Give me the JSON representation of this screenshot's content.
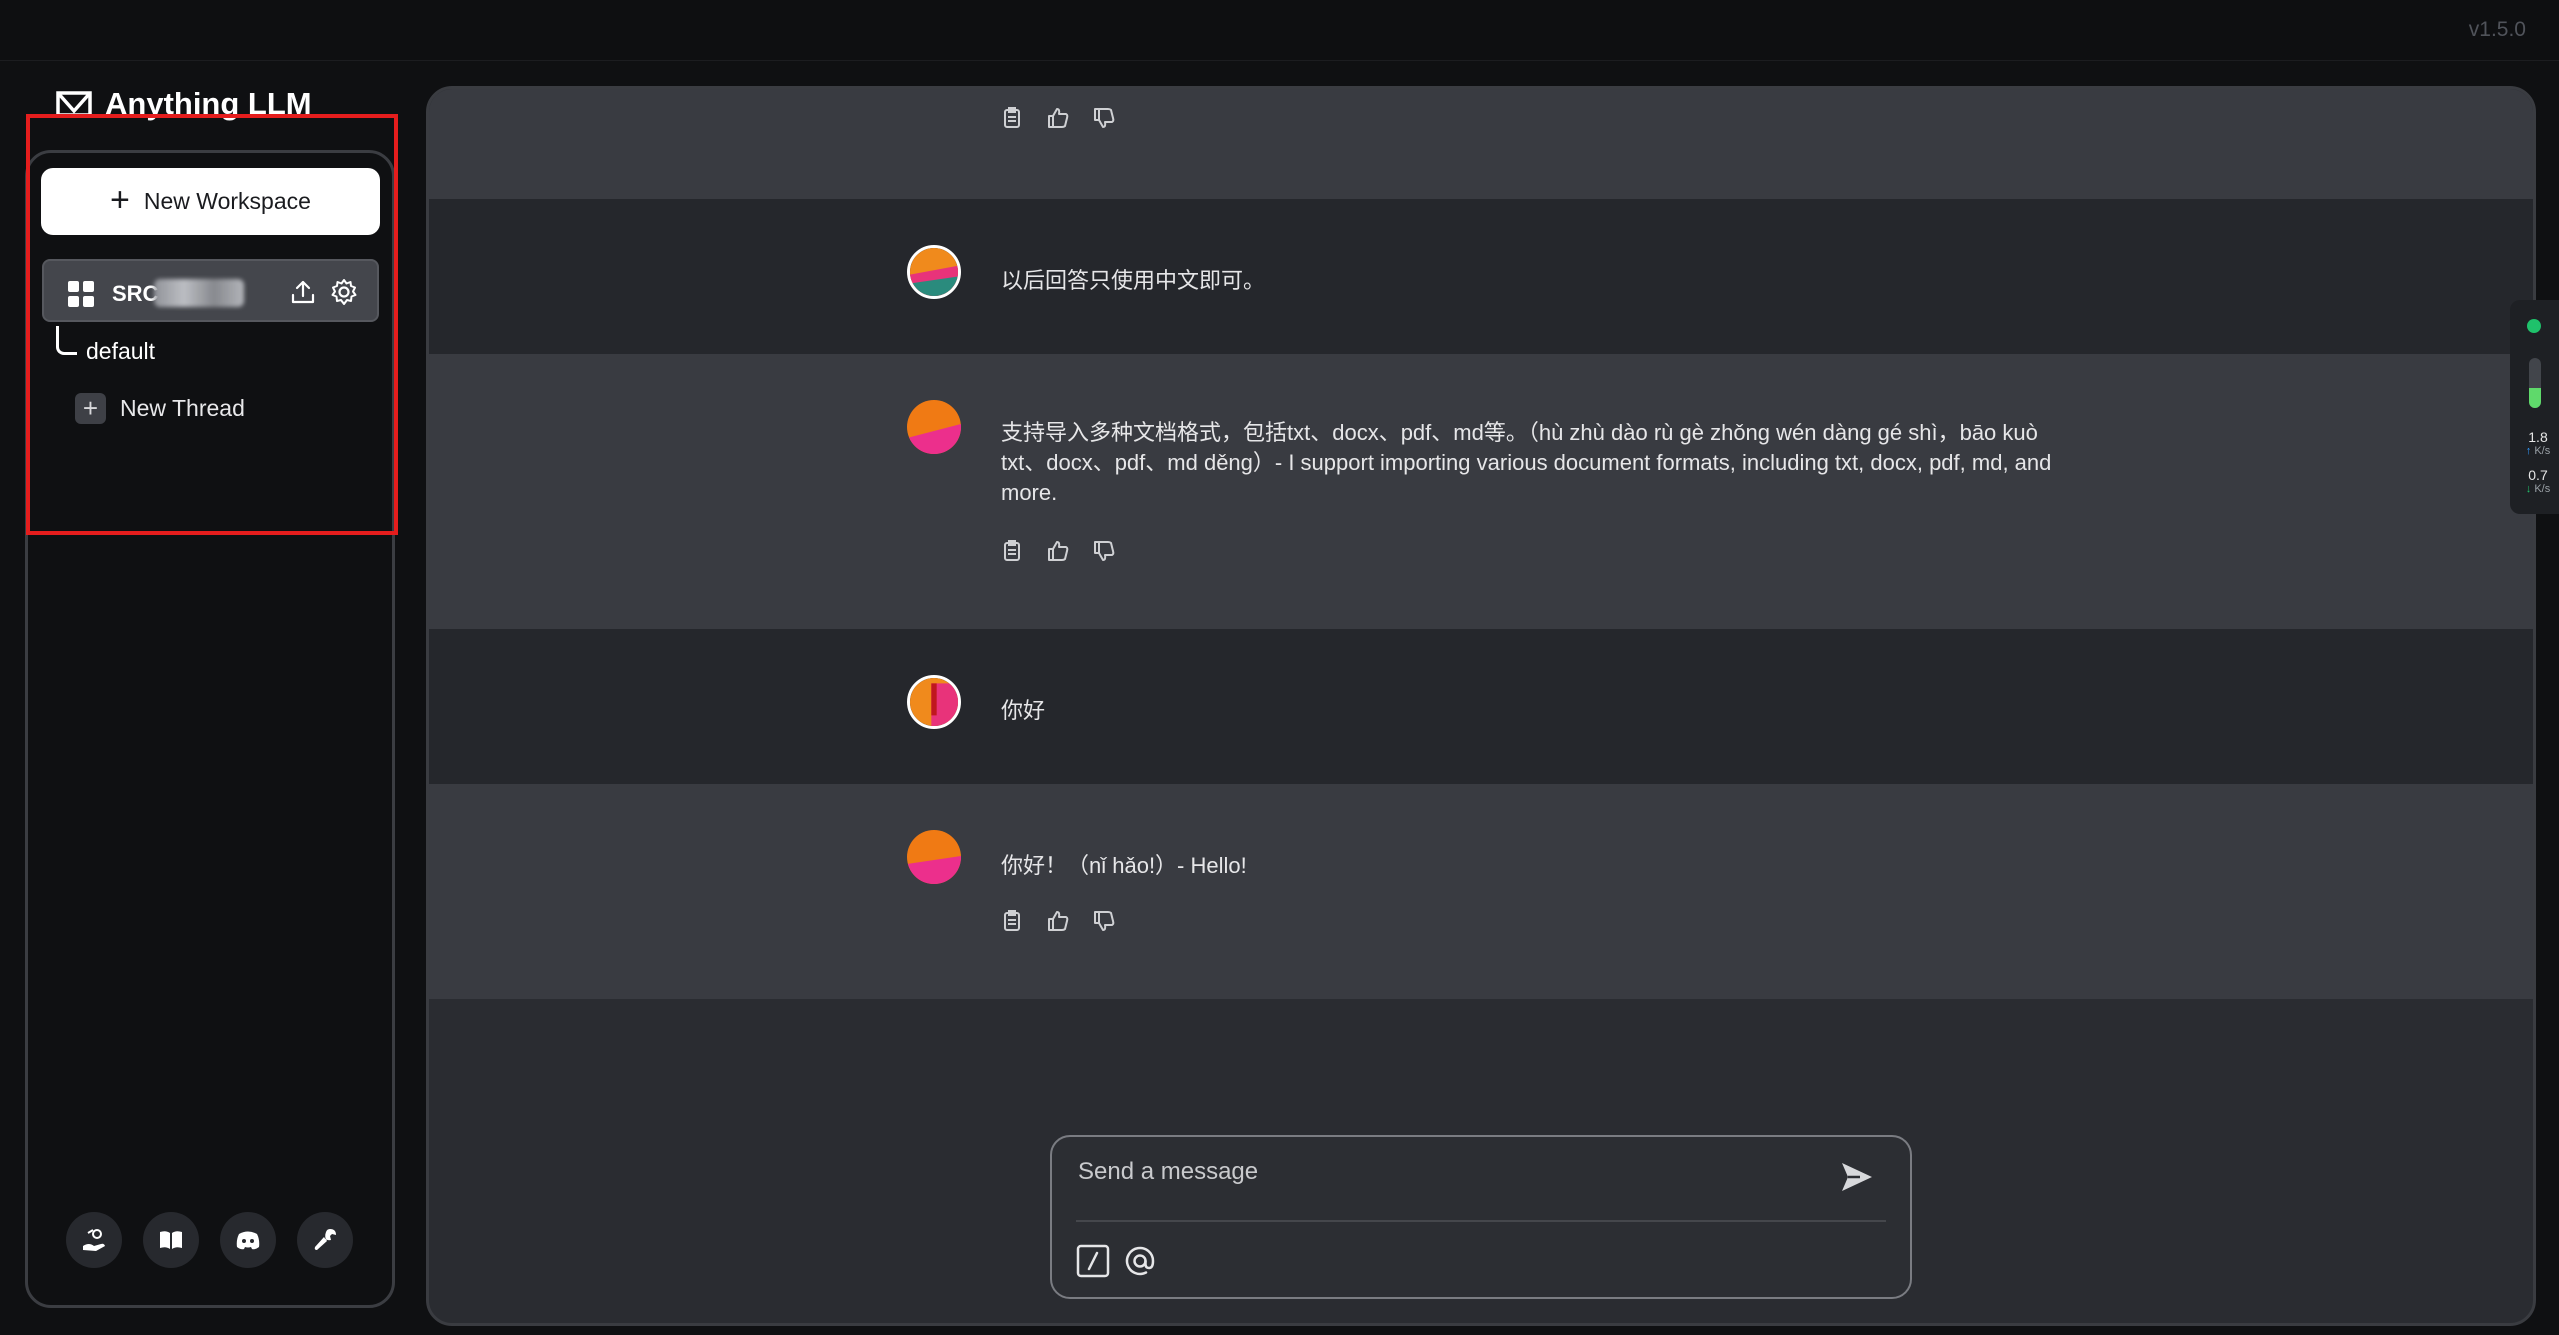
{
  "app": {
    "name": "Anything LLM",
    "version": "v1.5.0"
  },
  "sidebar": {
    "new_workspace_label": "New Workspace",
    "workspace": {
      "name": "SRC"
    },
    "threads": [
      {
        "label": "default"
      }
    ],
    "new_thread_label": "New Thread",
    "footer_icons": [
      "community-hub-icon",
      "docs-book-icon",
      "discord-icon",
      "wrench-settings-icon"
    ]
  },
  "chat": {
    "messages": [
      {
        "role": "user",
        "text": "以后回答只使用中文即可。"
      },
      {
        "role": "assistant",
        "text": "支持导入多种文档格式，包括txt、docx、pdf、md等。（hù zhù dào rù gè zhǒng wén dàng gé shì，bāo kuò txt、docx、pdf、md děng）- I support importing various document formats, including txt, docx, pdf, md, and more."
      },
      {
        "role": "user",
        "text": "你好"
      },
      {
        "role": "assistant",
        "text": "你好！（nǐ hǎo!）- Hello!"
      }
    ]
  },
  "composer": {
    "placeholder": "Send a message"
  },
  "network_monitor": {
    "upload_rate": "1.8",
    "download_rate": "0.7",
    "unit": "K/s",
    "status_color": "#1fc16b",
    "level": 0.4
  }
}
